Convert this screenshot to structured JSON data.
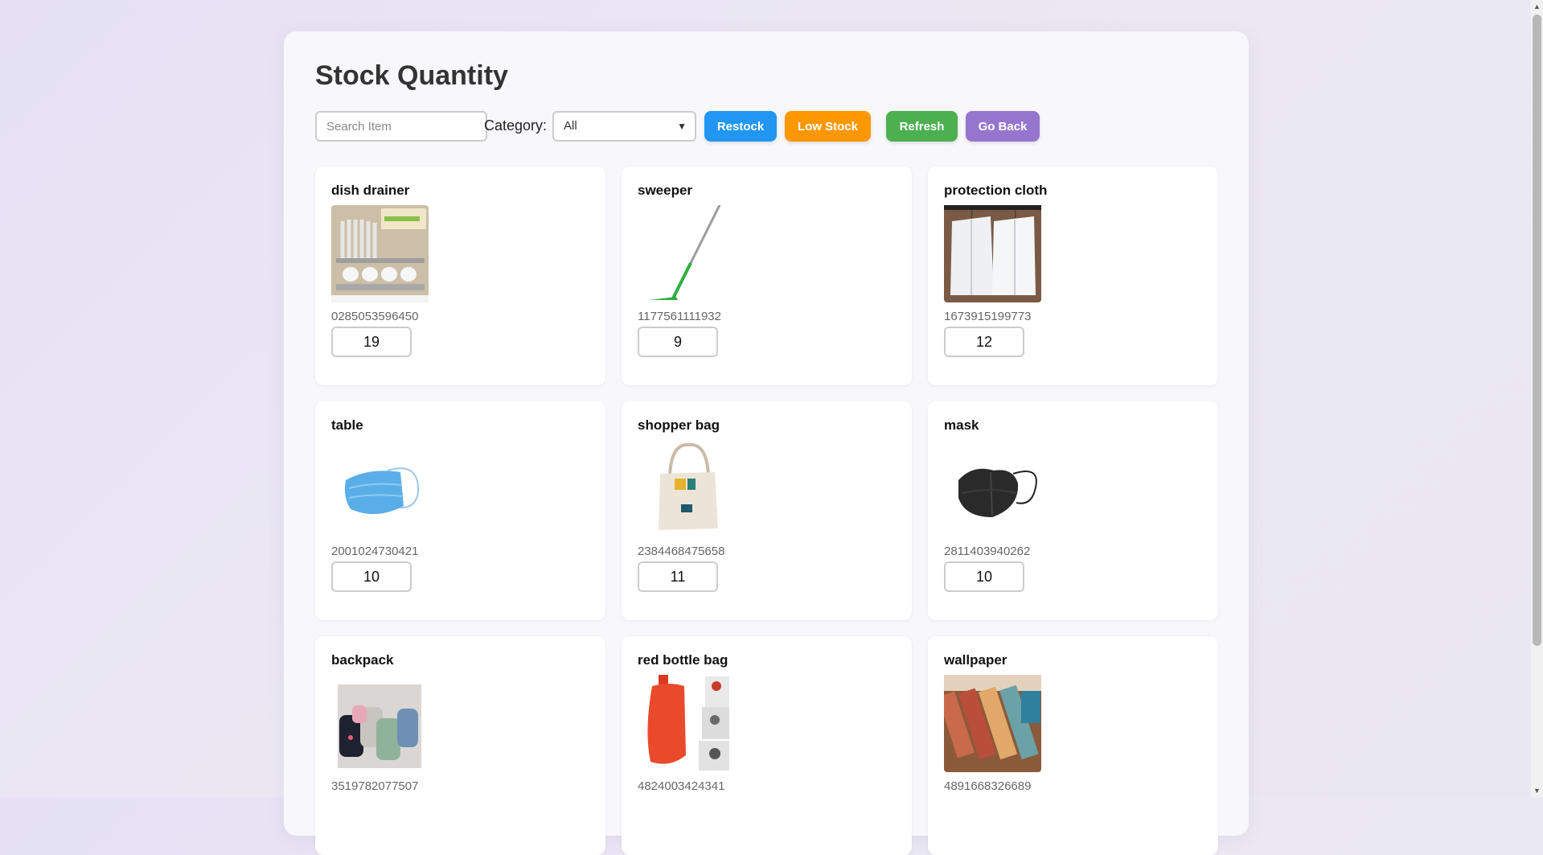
{
  "page": {
    "title": "Stock Quantity"
  },
  "toolbar": {
    "search_placeholder": "Search Item",
    "category_label": "Category:",
    "category_selected": "All",
    "restock": "Restock",
    "low_stock": "Low Stock",
    "refresh": "Refresh",
    "go_back": "Go Back"
  },
  "colors": {
    "restock": "#2196f3",
    "low_stock": "#ff9800",
    "refresh": "#4caf50",
    "go_back": "#9575cd"
  },
  "items": [
    {
      "name": "dish drainer",
      "code": "0285053596450",
      "qty": "19",
      "icon": "dish-drainer-image"
    },
    {
      "name": "sweeper",
      "code": "1177561111932",
      "qty": "9",
      "icon": "sweeper-image"
    },
    {
      "name": "protection cloth",
      "code": "1673915199773",
      "qty": "12",
      "icon": "garment-cover-image"
    },
    {
      "name": "table",
      "code": "2001024730421",
      "qty": "10",
      "icon": "face-mask-image"
    },
    {
      "name": "shopper bag",
      "code": "2384468475658",
      "qty": "11",
      "icon": "tote-bag-image"
    },
    {
      "name": "mask",
      "code": "2811403940262",
      "qty": "10",
      "icon": "black-mask-image"
    },
    {
      "name": "backpack",
      "code": "3519782077507",
      "qty": "",
      "icon": "backpacks-image"
    },
    {
      "name": "red bottle bag",
      "code": "4824003424341",
      "qty": "",
      "icon": "hot-water-bottle-image"
    },
    {
      "name": "wallpaper",
      "code": "4891668326689",
      "qty": "",
      "icon": "wallpaper-rolls-image"
    }
  ]
}
